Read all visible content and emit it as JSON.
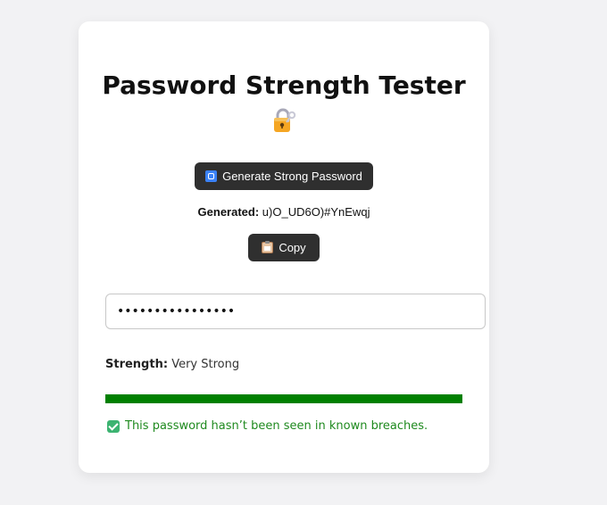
{
  "title": "Password Strength Tester",
  "title_icon": "locked-with-key-icon",
  "generate_button": {
    "label": "Generate Strong Password",
    "icon": "repeat-icon"
  },
  "generated": {
    "label": "Generated:",
    "value": "u)O_UD6O)#YnEwqj"
  },
  "copy_button": {
    "label": "Copy",
    "icon": "clipboard-icon"
  },
  "password_input": {
    "value": "u)O_UD6O)#YnEwqj",
    "type": "password"
  },
  "strength": {
    "label": "Strength:",
    "value": "Very Strong",
    "level": 1.0,
    "color": "#008000"
  },
  "breach": {
    "icon": "check-mark-icon",
    "message": "This password hasn’t been seen in known breaches.",
    "color": "#1f8a1f"
  }
}
